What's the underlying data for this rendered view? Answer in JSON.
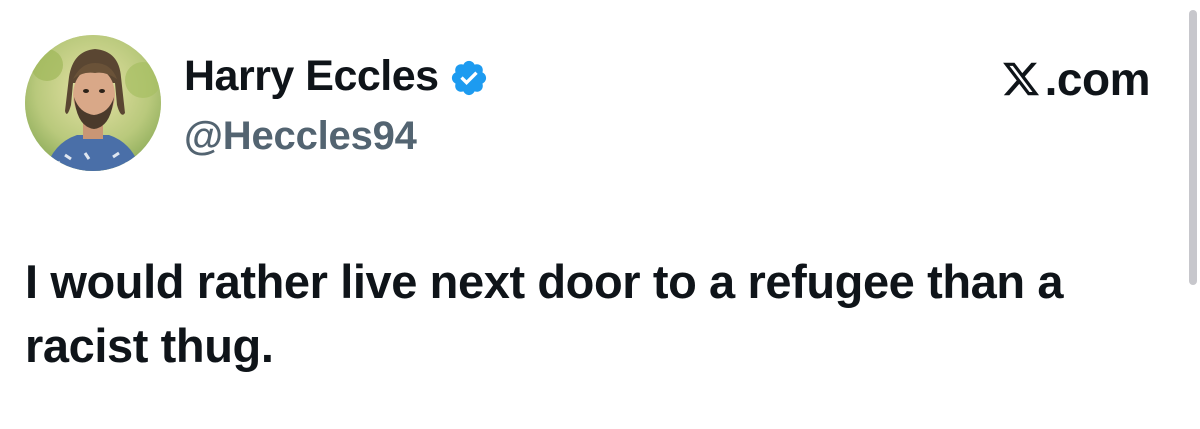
{
  "post": {
    "author": {
      "display_name": "Harry Eccles",
      "handle": "@Heccles94",
      "verified": true,
      "avatar_icon": "profile-photo"
    },
    "site": {
      "label": ".com",
      "logo_icon": "x-logo-icon"
    },
    "text": "I would rather live next door to a refugee than a racist thug."
  },
  "colors": {
    "text_primary": "#0f1419",
    "text_secondary": "#536471",
    "verified_blue": "#1d9bf0",
    "background": "#ffffff"
  }
}
